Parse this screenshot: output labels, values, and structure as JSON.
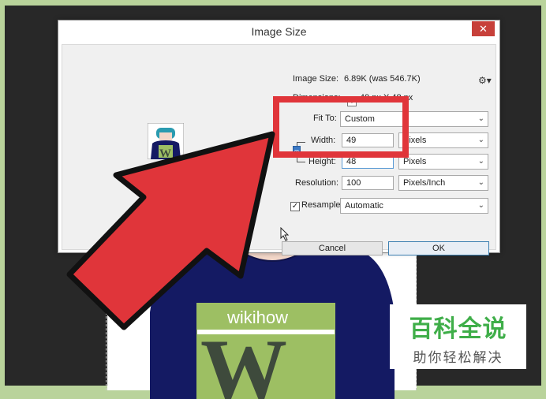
{
  "dialog": {
    "title": "Image Size",
    "close_glyph": "✕",
    "image_size_label": "Image Size:",
    "image_size_value": "6.89K (was 546.7K)",
    "dimensions_label": "Dimensions:",
    "dimensions_value": "49 px  X  48 px",
    "fit_to_label": "Fit To:",
    "fit_to_value": "Custom",
    "width_label": "Width:",
    "width_value": "49",
    "width_unit": "Pixels",
    "height_label": "Height:",
    "height_value": "48",
    "height_unit": "Pixels",
    "resolution_label": "Resolution:",
    "resolution_value": "100",
    "resolution_unit": "Pixels/Inch",
    "resample_label": "Resample:",
    "resample_checked": true,
    "resample_value": "Automatic",
    "cancel_label": "Cancel",
    "ok_label": "OK",
    "gear_icon": "gear-icon"
  },
  "preview": {
    "logo_letter": "W"
  },
  "sweater": {
    "brand": "wikihow",
    "letter": "W"
  },
  "watermark": {
    "title": "百科全说",
    "subtitle": "助你轻松解决"
  },
  "colors": {
    "accent_red": "#e0353a",
    "sweater_navy": "#141a63",
    "logo_green": "#9dbf63",
    "watermark_green": "#3fae49"
  }
}
